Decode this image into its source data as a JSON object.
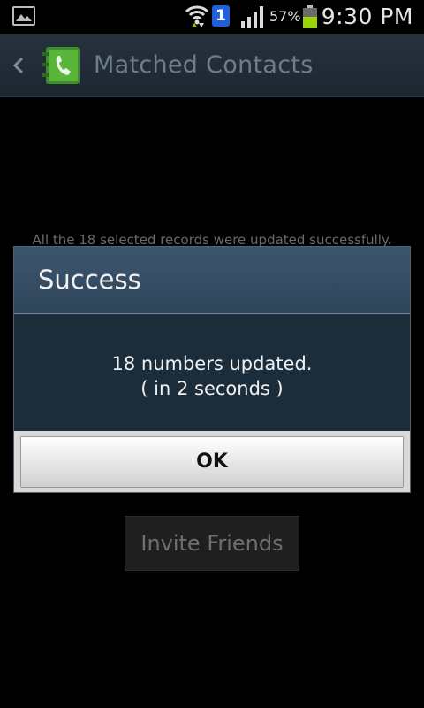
{
  "status_bar": {
    "notification_badge": "1",
    "battery_percent": "57%",
    "time": "9:30 PM",
    "icons": [
      "gallery-icon",
      "wifi-icon",
      "signal-icon",
      "battery-icon"
    ]
  },
  "action_bar": {
    "title": "Matched Contacts",
    "back_icon": "chevron-left-icon",
    "app_icon": "contacts-book-icon"
  },
  "background": {
    "message": "All the 18 selected records were updated successfully.",
    "invite_button_label": "Invite Friends"
  },
  "dialog": {
    "title": "Success",
    "message_line1": "18 numbers updated.",
    "message_line2": "( in 2 seconds )",
    "ok_label": "OK"
  },
  "colors": {
    "dialog_title_bg": "#3d5670",
    "dialog_body_bg": "#1b2c3b",
    "battery_fill": "#9ad600",
    "badge_blue": "#1f5fd8"
  }
}
